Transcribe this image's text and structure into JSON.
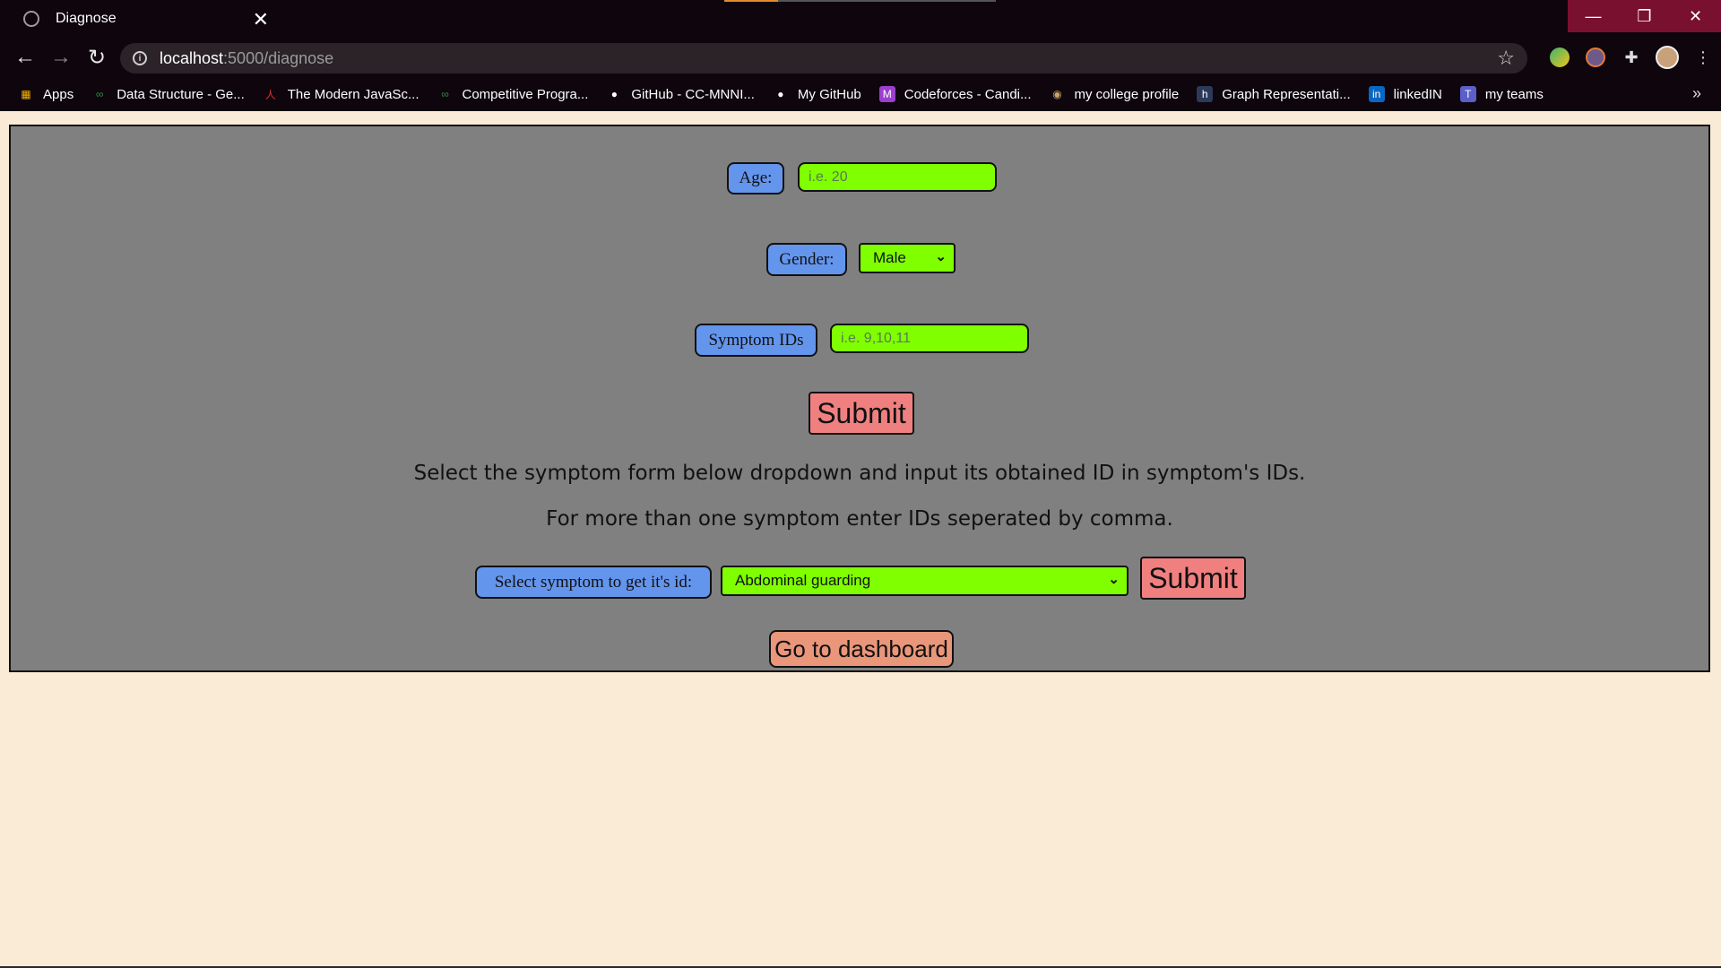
{
  "browser": {
    "tab_title": "Diagnose",
    "tab_close": "✕",
    "url_host": "localhost",
    "url_path": ":5000/diagnose",
    "bookmarks": [
      {
        "label": "Apps",
        "icon": "apps-grid-icon"
      },
      {
        "label": "Data Structure - Ge...",
        "icon": "geeksforgeeks-icon"
      },
      {
        "label": "The Modern JavaSc...",
        "icon": "javascript-info-icon"
      },
      {
        "label": "Competitive Progra...",
        "icon": "geeksforgeeks-icon"
      },
      {
        "label": "GitHub - CC-MNNI...",
        "icon": "github-icon"
      },
      {
        "label": "My GitHub",
        "icon": "github-icon"
      },
      {
        "label": "Codeforces - Candi...",
        "icon": "codeforces-icon"
      },
      {
        "label": "my college profile",
        "icon": "college-icon"
      },
      {
        "label": "Graph Representati...",
        "icon": "hackerearth-icon"
      },
      {
        "label": "linkedIN",
        "icon": "linkedin-icon"
      },
      {
        "label": "my teams",
        "icon": "teams-icon"
      }
    ],
    "more_bookmarks": "»"
  },
  "form": {
    "age_label": "Age:",
    "age_placeholder": "i.e. 20",
    "gender_label": "Gender:",
    "gender_value": "Male",
    "symptom_ids_label": "Symptom IDs",
    "symptom_ids_placeholder": "i.e. 9,10,11",
    "submit_label": "Submit"
  },
  "instructions": {
    "line1": "Select the symptom form below dropdown and input its obtained ID in symptom's IDs.",
    "line2": "For more than one symptom enter IDs seperated by comma."
  },
  "symptom_lookup": {
    "label": "Select symptom to get it's id:",
    "selected": "Abdominal guarding",
    "submit_label": "Submit"
  },
  "dashboard_button": "Go to dashboard",
  "colors": {
    "panel": "#808080",
    "page_background": "#faebd7",
    "label_blue": "#6495ed",
    "input_green": "#7fff00",
    "submit_salmon": "#f08080"
  }
}
